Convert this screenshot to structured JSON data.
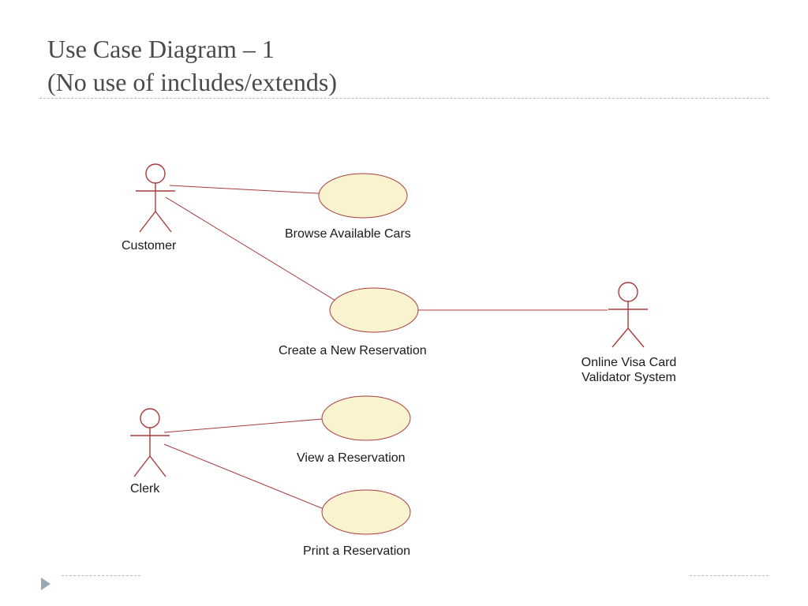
{
  "title": {
    "line1": "Use Case Diagram – 1",
    "line2": "(No use of includes/extends)"
  },
  "actors": {
    "customer": "Customer",
    "clerk": "Clerk",
    "visa": "Online Visa Card Validator System"
  },
  "usecases": {
    "browse": "Browse Available Cars",
    "create": "Create a New Reservation",
    "view": "View a Reservation",
    "print": "Print a Reservation"
  }
}
